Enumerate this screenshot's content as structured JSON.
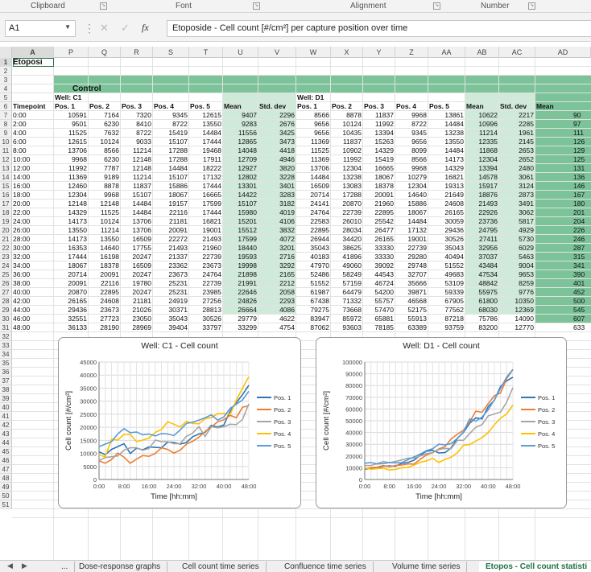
{
  "ribbon": {
    "groups": [
      "Clipboard",
      "Font",
      "Alignment",
      "Number"
    ]
  },
  "formula_bar": {
    "name_box": "A1",
    "formula": "Etoposide - Cell count [#/cm²] per capture position over time"
  },
  "columns": [
    "A",
    "P",
    "Q",
    "R",
    "S",
    "T",
    "U",
    "V",
    "W",
    "X",
    "Y",
    "Z",
    "AA",
    "AB",
    "AC",
    "AD"
  ],
  "row_numbers": [
    "1",
    "2",
    "3",
    "4",
    "5",
    "6",
    "7",
    "8",
    "9",
    "10",
    "11",
    "12",
    "13",
    "14",
    "15",
    "16",
    "17",
    "18",
    "19",
    "20",
    "21",
    "22",
    "23",
    "24",
    "25",
    "26",
    "27",
    "28",
    "29",
    "30",
    "31",
    "32",
    "33",
    "34",
    "35",
    "36",
    "37",
    "38",
    "39",
    "40",
    "41",
    "42",
    "43",
    "44",
    "45",
    "46",
    "47",
    "48",
    "49",
    "50",
    "51"
  ],
  "sheet": {
    "a1": "Etoposi",
    "control_label": "Control",
    "well_c1": "Well: C1",
    "well_d1": "Well: D1",
    "timepoint_header": "Timepoint",
    "headers_c1": [
      "Pos. 1",
      "Pos. 2",
      "Pos. 3",
      "Pos. 4",
      "Pos. 5",
      "Mean",
      "Std. dev"
    ],
    "headers_d1": [
      "Pos. 1",
      "Pos. 2",
      "Pos. 3",
      "Pos. 4",
      "Pos. 5",
      "Mean",
      "Std. dev",
      "Mean"
    ],
    "timepoints": [
      "0:00",
      "2:00",
      "4:00",
      "6:00",
      "8:00",
      "10:00",
      "12:00",
      "14:00",
      "16:00",
      "18:00",
      "20:00",
      "22:00",
      "24:00",
      "26:00",
      "28:00",
      "30:00",
      "32:00",
      "34:00",
      "36:00",
      "38:00",
      "40:00",
      "42:00",
      "44:00",
      "46:00",
      "48:00"
    ],
    "rows_c1": [
      [
        "10591",
        "7164",
        "7320",
        "9345",
        "12615",
        "9407",
        "2296"
      ],
      [
        "9501",
        "6230",
        "8410",
        "8722",
        "13550",
        "9283",
        "2676"
      ],
      [
        "11525",
        "7632",
        "8722",
        "15419",
        "14484",
        "11556",
        "3425"
      ],
      [
        "12615",
        "10124",
        "9033",
        "15107",
        "17444",
        "12865",
        "3473"
      ],
      [
        "13706",
        "8566",
        "11214",
        "17288",
        "19468",
        "14048",
        "4418"
      ],
      [
        "9968",
        "6230",
        "12148",
        "17288",
        "17911",
        "12709",
        "4946"
      ],
      [
        "11992",
        "7787",
        "12148",
        "14484",
        "18222",
        "12927",
        "3820"
      ],
      [
        "11369",
        "9189",
        "11214",
        "15107",
        "17132",
        "12802",
        "3228"
      ],
      [
        "12460",
        "8878",
        "11837",
        "15886",
        "17444",
        "13301",
        "3401"
      ],
      [
        "12304",
        "9968",
        "15107",
        "18067",
        "16665",
        "14422",
        "3283"
      ],
      [
        "12148",
        "12148",
        "14484",
        "19157",
        "17599",
        "15107",
        "3182"
      ],
      [
        "14329",
        "11525",
        "14484",
        "22116",
        "17444",
        "15980",
        "4019"
      ],
      [
        "14173",
        "10124",
        "13706",
        "21181",
        "16821",
        "15201",
        "4106"
      ],
      [
        "13550",
        "11214",
        "13706",
        "20091",
        "19001",
        "15512",
        "3832"
      ],
      [
        "14173",
        "13550",
        "16509",
        "22272",
        "21493",
        "17599",
        "4072"
      ],
      [
        "16353",
        "14640",
        "17755",
        "21493",
        "21960",
        "18440",
        "3201"
      ],
      [
        "17444",
        "16198",
        "20247",
        "21337",
        "22739",
        "19593",
        "2716"
      ],
      [
        "18067",
        "18378",
        "16509",
        "23362",
        "23673",
        "19998",
        "3292"
      ],
      [
        "20714",
        "20091",
        "20247",
        "23673",
        "24764",
        "21898",
        "2165"
      ],
      [
        "20091",
        "22116",
        "19780",
        "25231",
        "22739",
        "21991",
        "2212"
      ],
      [
        "20870",
        "22895",
        "20247",
        "25231",
        "23985",
        "22646",
        "2058"
      ],
      [
        "26165",
        "24608",
        "21181",
        "24919",
        "27256",
        "24826",
        "2293"
      ],
      [
        "29436",
        "23673",
        "21026",
        "30371",
        "28813",
        "26664",
        "4086"
      ],
      [
        "32551",
        "27723",
        "23050",
        "35043",
        "30526",
        "29779",
        "4622"
      ],
      [
        "36133",
        "28190",
        "28969",
        "39404",
        "33797",
        "33299",
        "4754"
      ]
    ],
    "rows_d1": [
      [
        "8566",
        "8878",
        "11837",
        "9968",
        "13861",
        "10622",
        "2217",
        "90"
      ],
      [
        "9656",
        "10124",
        "11992",
        "8722",
        "14484",
        "10996",
        "2285",
        "97"
      ],
      [
        "9656",
        "10435",
        "13394",
        "9345",
        "13238",
        "11214",
        "1961",
        "111"
      ],
      [
        "11369",
        "11837",
        "15263",
        "9656",
        "13550",
        "12335",
        "2145",
        "126"
      ],
      [
        "11525",
        "10902",
        "14329",
        "8099",
        "14484",
        "11868",
        "2653",
        "129"
      ],
      [
        "11369",
        "11992",
        "15419",
        "8566",
        "14173",
        "12304",
        "2652",
        "125"
      ],
      [
        "13706",
        "12304",
        "16665",
        "9968",
        "14329",
        "13394",
        "2480",
        "131"
      ],
      [
        "14484",
        "13238",
        "18067",
        "10279",
        "16821",
        "14578",
        "3061",
        "136"
      ],
      [
        "16509",
        "13083",
        "18378",
        "12304",
        "19313",
        "15917",
        "3124",
        "146"
      ],
      [
        "20714",
        "17288",
        "20091",
        "14640",
        "21649",
        "18876",
        "2873",
        "167"
      ],
      [
        "24141",
        "20870",
        "21960",
        "15886",
        "24608",
        "21493",
        "3491",
        "180"
      ],
      [
        "24764",
        "22739",
        "22895",
        "18067",
        "26165",
        "22926",
        "3062",
        "201"
      ],
      [
        "22583",
        "26010",
        "25542",
        "14484",
        "30059",
        "23736",
        "5817",
        "204"
      ],
      [
        "22895",
        "28034",
        "26477",
        "17132",
        "29436",
        "24795",
        "4929",
        "226"
      ],
      [
        "26944",
        "34420",
        "26165",
        "19001",
        "30526",
        "27411",
        "5730",
        "246"
      ],
      [
        "35043",
        "38625",
        "33330",
        "22739",
        "35043",
        "32956",
        "6029",
        "287"
      ],
      [
        "40183",
        "41896",
        "33330",
        "29280",
        "40494",
        "37037",
        "5463",
        "315"
      ],
      [
        "47970",
        "49060",
        "39092",
        "29748",
        "51552",
        "43484",
        "9004",
        "341"
      ],
      [
        "52486",
        "58249",
        "44543",
        "32707",
        "49683",
        "47534",
        "9653",
        "390"
      ],
      [
        "51552",
        "57159",
        "46724",
        "35666",
        "53109",
        "48842",
        "8259",
        "401"
      ],
      [
        "61987",
        "64479",
        "54200",
        "39871",
        "59339",
        "55975",
        "9776",
        "452"
      ],
      [
        "67438",
        "71332",
        "55757",
        "46568",
        "67905",
        "61800",
        "10350",
        "500"
      ],
      [
        "79275",
        "73668",
        "57470",
        "52175",
        "77562",
        "68030",
        "12369",
        "545"
      ],
      [
        "83947",
        "85972",
        "65881",
        "55913",
        "87218",
        "75786",
        "14090",
        "607"
      ],
      [
        "87062",
        "93603",
        "78185",
        "63389",
        "93759",
        "83200",
        "12770",
        "633"
      ]
    ]
  },
  "charts": [
    {
      "title": "Well: C1 - Cell count",
      "ylabel": "Cell count [#/cm²]",
      "xlabel": "Time [hh:mm]",
      "yticks": [
        "0",
        "5000",
        "10000",
        "15000",
        "20000",
        "25000",
        "30000",
        "35000",
        "40000",
        "45000"
      ],
      "ymax": 45000,
      "xticks": [
        "0:00",
        "8:00",
        "16:00",
        "24:00",
        "32:00",
        "40:00",
        "48:00"
      ]
    },
    {
      "title": "Well: D1 - Cell count",
      "ylabel": "Cell count [#/cm²]",
      "xlabel": "Time [hh:mm]",
      "yticks": [
        "0",
        "10000",
        "20000",
        "30000",
        "40000",
        "50000",
        "60000",
        "70000",
        "80000",
        "90000",
        "100000"
      ],
      "ymax": 100000,
      "xticks": [
        "0:00",
        "8:00",
        "16:00",
        "24:00",
        "32:00",
        "40:00",
        "48:00"
      ]
    }
  ],
  "legend": {
    "names": [
      "Pos. 1",
      "Pos. 2",
      "Pos. 3",
      "Pos. 4",
      "Pos. 5"
    ],
    "colors": [
      "#2e75b6",
      "#ed7d31",
      "#a5a5a5",
      "#ffc000",
      "#5b9bd5"
    ]
  },
  "tabs": {
    "nav_prev": "◀",
    "nav_next": "▶",
    "more": "...",
    "items": [
      "Dose-response graphs",
      "Cell count time series",
      "Confluence time series",
      "Volume time series",
      "Etopos - Cell count statisti"
    ]
  },
  "chart_data": [
    {
      "type": "line",
      "title": "Well: C1 - Cell count",
      "xlabel": "Time [hh:mm]",
      "ylabel": "Cell count [#/cm²]",
      "ylim": [
        0,
        45000
      ],
      "x": [
        "0:00",
        "2:00",
        "4:00",
        "6:00",
        "8:00",
        "10:00",
        "12:00",
        "14:00",
        "16:00",
        "18:00",
        "20:00",
        "22:00",
        "24:00",
        "26:00",
        "28:00",
        "30:00",
        "32:00",
        "34:00",
        "36:00",
        "38:00",
        "40:00",
        "42:00",
        "44:00",
        "46:00",
        "48:00"
      ],
      "series": [
        {
          "name": "Pos. 1",
          "values": [
            10591,
            9501,
            11525,
            12615,
            13706,
            9968,
            11992,
            11369,
            12460,
            12304,
            12148,
            14329,
            14173,
            13550,
            14173,
            16353,
            17444,
            18067,
            20714,
            20091,
            20870,
            26165,
            29436,
            32551,
            36133
          ]
        },
        {
          "name": "Pos. 2",
          "values": [
            7164,
            6230,
            7632,
            10124,
            8566,
            6230,
            7787,
            9189,
            8878,
            9968,
            12148,
            11525,
            10124,
            11214,
            13550,
            14640,
            16198,
            18378,
            20091,
            22116,
            22895,
            24608,
            23673,
            27723,
            28190
          ]
        },
        {
          "name": "Pos. 3",
          "values": [
            7320,
            8410,
            8722,
            9033,
            11214,
            12148,
            12148,
            11214,
            11837,
            15107,
            14484,
            14484,
            13706,
            13706,
            16509,
            17755,
            20247,
            16509,
            20247,
            19780,
            20247,
            21181,
            21026,
            23050,
            28969
          ]
        },
        {
          "name": "Pos. 4",
          "values": [
            9345,
            8722,
            15419,
            15107,
            17288,
            17288,
            14484,
            15107,
            15886,
            18067,
            19157,
            22116,
            21181,
            20091,
            22272,
            21493,
            21337,
            23362,
            23673,
            25231,
            25231,
            24919,
            30371,
            35043,
            39404
          ]
        },
        {
          "name": "Pos. 5",
          "values": [
            12615,
            13550,
            14484,
            17444,
            19468,
            17911,
            18222,
            17132,
            17444,
            16665,
            17599,
            17444,
            16821,
            19001,
            21493,
            21960,
            22739,
            23673,
            24764,
            22739,
            23985,
            27256,
            28813,
            30526,
            33797
          ]
        }
      ]
    },
    {
      "type": "line",
      "title": "Well: D1 - Cell count",
      "xlabel": "Time [hh:mm]",
      "ylabel": "Cell count [#/cm²]",
      "ylim": [
        0,
        100000
      ],
      "x": [
        "0:00",
        "2:00",
        "4:00",
        "6:00",
        "8:00",
        "10:00",
        "12:00",
        "14:00",
        "16:00",
        "18:00",
        "20:00",
        "22:00",
        "24:00",
        "26:00",
        "28:00",
        "30:00",
        "32:00",
        "34:00",
        "36:00",
        "38:00",
        "40:00",
        "42:00",
        "44:00",
        "46:00",
        "48:00"
      ],
      "series": [
        {
          "name": "Pos. 1",
          "values": [
            8566,
            9656,
            9656,
            11369,
            11525,
            11369,
            13706,
            14484,
            16509,
            20714,
            24141,
            24764,
            22583,
            22895,
            26944,
            35043,
            40183,
            47970,
            52486,
            51552,
            61987,
            67438,
            79275,
            83947,
            87062
          ]
        },
        {
          "name": "Pos. 2",
          "values": [
            8878,
            10124,
            10435,
            11837,
            10902,
            11992,
            12304,
            13238,
            13083,
            17288,
            20870,
            22739,
            26010,
            28034,
            34420,
            38625,
            41896,
            49060,
            58249,
            57159,
            64479,
            71332,
            73668,
            85972,
            93603
          ]
        },
        {
          "name": "Pos. 3",
          "values": [
            11837,
            11992,
            13394,
            15263,
            14329,
            15419,
            16665,
            18067,
            18378,
            20091,
            21960,
            22895,
            25542,
            26477,
            26165,
            33330,
            33330,
            39092,
            44543,
            46724,
            54200,
            55757,
            57470,
            65881,
            78185
          ]
        },
        {
          "name": "Pos. 4",
          "values": [
            9968,
            8722,
            9345,
            9656,
            8099,
            8566,
            9968,
            10279,
            12304,
            14640,
            15886,
            18067,
            14484,
            17132,
            19001,
            22739,
            29280,
            29748,
            32707,
            35666,
            39871,
            46568,
            52175,
            55913,
            63389
          ]
        },
        {
          "name": "Pos. 5",
          "values": [
            13861,
            14484,
            13238,
            13550,
            14484,
            14173,
            14329,
            16821,
            19313,
            21649,
            24608,
            26165,
            30059,
            29436,
            30526,
            35043,
            40494,
            51552,
            49683,
            53109,
            59339,
            67905,
            77562,
            87218,
            93759
          ]
        }
      ]
    }
  ]
}
